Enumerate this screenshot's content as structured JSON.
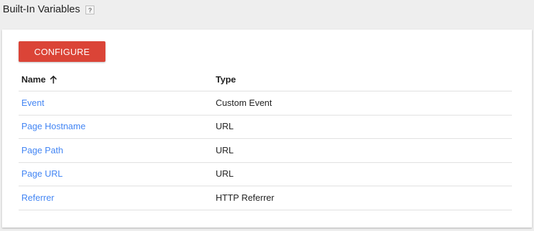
{
  "page": {
    "title": "Built-In Variables",
    "help_label": "?"
  },
  "toolbar": {
    "configure_label": "CONFIGURE",
    "configure_color": "#db4437"
  },
  "table": {
    "headers": {
      "name": "Name",
      "type": "Type",
      "sort_icon": "arrow-up-icon"
    },
    "rows": [
      {
        "name": "Event",
        "type": "Custom Event"
      },
      {
        "name": "Page Hostname",
        "type": "URL"
      },
      {
        "name": "Page Path",
        "type": "URL"
      },
      {
        "name": "Page URL",
        "type": "URL"
      },
      {
        "name": "Referrer",
        "type": "HTTP Referrer"
      }
    ]
  },
  "colors": {
    "link": "#4285f4",
    "background": "#eeeeee"
  }
}
